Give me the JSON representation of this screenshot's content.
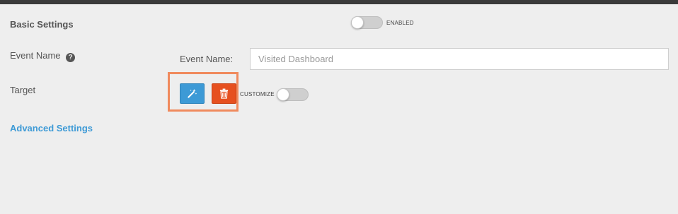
{
  "header": {
    "title": "Basic Settings"
  },
  "enabled_toggle": {
    "label": "ENABLED",
    "state": "off"
  },
  "form": {
    "event_name_label": "Event Name",
    "event_name_field_label": "Event Name:",
    "event_name_placeholder": "Visited Dashboard",
    "target_label": "Target"
  },
  "target_controls": {
    "wand_button_icon": "magic-wand-icon",
    "trash_button_icon": "trash-icon",
    "customize_label": "CUSTOMIZE",
    "customize_state": "off"
  },
  "advanced_link": "Advanced Settings",
  "colors": {
    "accent": "#3d9ad6",
    "danger": "#e6501f",
    "highlight": "#f08a5d",
    "background": "#eeeeee"
  }
}
